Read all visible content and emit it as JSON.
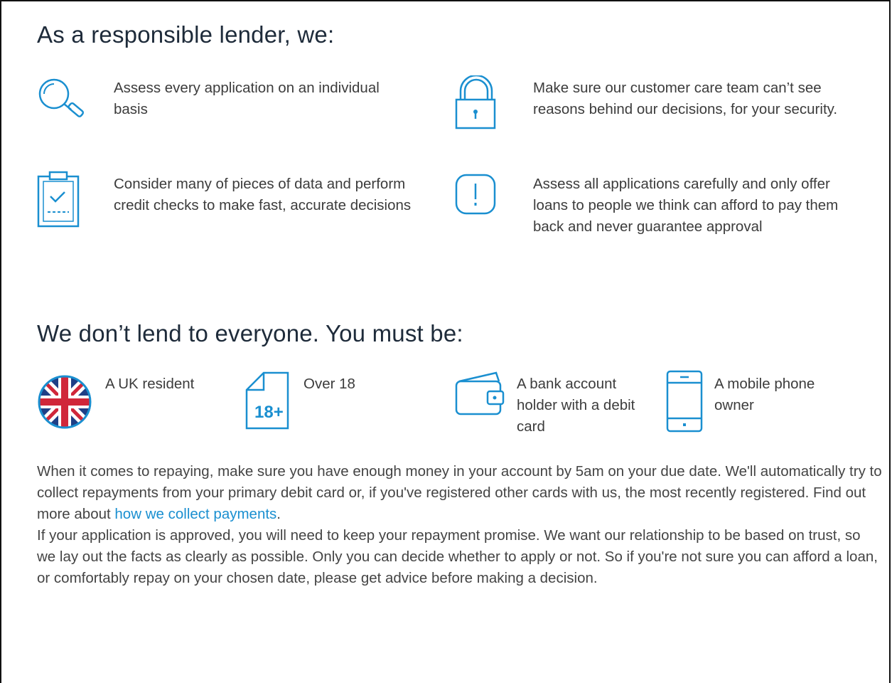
{
  "section1": {
    "heading": "As a responsible lender, we:",
    "items": [
      {
        "icon": "magnifier-icon",
        "text": "Assess every application on an individual basis"
      },
      {
        "icon": "padlock-icon",
        "text": "Make sure our customer care team can’t see reasons behind our decisions, for your security."
      },
      {
        "icon": "clipboard-icon",
        "text": "Consider many of pieces of data and perform credit checks to make fast, accurate decisions"
      },
      {
        "icon": "exclamation-icon",
        "text": "Assess all applications carefully and only offer loans to people we think can afford to pay them back and never guarantee approval"
      }
    ]
  },
  "section2": {
    "heading": "We don’t lend to everyone. You must be:",
    "requirements": [
      {
        "icon": "uk-flag-icon",
        "text": "A UK resident"
      },
      {
        "icon": "age-18-icon",
        "text": "Over 18",
        "badge": "18+"
      },
      {
        "icon": "wallet-icon",
        "text": "A bank account holder with a debit card"
      },
      {
        "icon": "mobile-phone-icon",
        "text": "A mobile phone owner"
      }
    ]
  },
  "repay": {
    "text_before": "When it comes to repaying, make sure you have enough money in your account by 5am on your due date. We'll automatically try to collect repayments from your primary debit card or, if you've registered other cards with us, the most recently registered. Find out more about ",
    "link_text": "how we collect payments",
    "text_after": "."
  },
  "approval": {
    "text": "If your application is approved, you will need to keep your repayment promise. We want our relationship to be based on trust, so we lay out the facts as clearly as possible. Only you can decide whether to apply or not. So if you're not sure you can afford a loan, or comfortably repay on your chosen date, please get advice before making a decision."
  },
  "colors": {
    "accent": "#1a8fd0",
    "heading": "#1e2b3a",
    "text": "#3c3c3c"
  }
}
